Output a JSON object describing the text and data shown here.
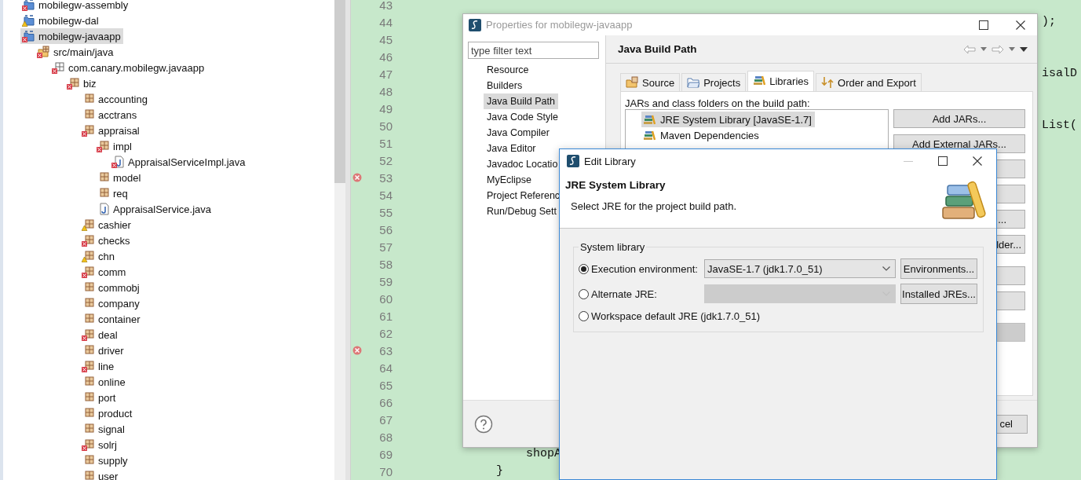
{
  "project_explorer": {
    "items": [
      {
        "label": "mobilegw-assembly",
        "kind": "project",
        "error": true,
        "warning": false,
        "selected": false
      },
      {
        "label": "mobilegw-dal",
        "kind": "project",
        "error": false,
        "warning": true,
        "selected": false
      },
      {
        "label": "mobilegw-javaapp",
        "kind": "project",
        "error": true,
        "warning": false,
        "selected": true,
        "children": [
          {
            "label": "src/main/java",
            "kind": "source-folder",
            "error": true,
            "warning": false,
            "selected": false,
            "children": [
              {
                "label": "com.canary.mobilegw.javaapp",
                "kind": "empty-package",
                "error": true,
                "warning": false,
                "selected": false,
                "children": [
                  {
                    "label": "biz",
                    "kind": "package",
                    "error": true,
                    "warning": false,
                    "selected": false,
                    "children": [
                      {
                        "label": "accounting",
                        "kind": "package",
                        "error": false,
                        "warning": false,
                        "selected": false
                      },
                      {
                        "label": "acctrans",
                        "kind": "package",
                        "error": false,
                        "warning": false,
                        "selected": false
                      },
                      {
                        "label": "appraisal",
                        "kind": "package",
                        "error": true,
                        "warning": false,
                        "selected": false,
                        "children": [
                          {
                            "label": "impl",
                            "kind": "package",
                            "error": true,
                            "warning": false,
                            "selected": false,
                            "children": [
                              {
                                "label": "AppraisalServiceImpl.java",
                                "kind": "file",
                                "error": true,
                                "warning": false,
                                "selected": false
                              }
                            ]
                          },
                          {
                            "label": "model",
                            "kind": "package",
                            "error": false,
                            "warning": false,
                            "selected": false
                          },
                          {
                            "label": "req",
                            "kind": "package",
                            "error": false,
                            "warning": false,
                            "selected": false
                          },
                          {
                            "label": "AppraisalService.java",
                            "kind": "file",
                            "error": false,
                            "warning": false,
                            "selected": false
                          }
                        ]
                      },
                      {
                        "label": "cashier",
                        "kind": "package",
                        "error": false,
                        "warning": true,
                        "selected": false
                      },
                      {
                        "label": "checks",
                        "kind": "package",
                        "error": true,
                        "warning": false,
                        "selected": false
                      },
                      {
                        "label": "chn",
                        "kind": "package",
                        "error": false,
                        "warning": true,
                        "selected": false
                      },
                      {
                        "label": "comm",
                        "kind": "package",
                        "error": true,
                        "warning": false,
                        "selected": false
                      },
                      {
                        "label": "commobj",
                        "kind": "package",
                        "error": false,
                        "warning": false,
                        "selected": false
                      },
                      {
                        "label": "company",
                        "kind": "package",
                        "error": false,
                        "warning": false,
                        "selected": false
                      },
                      {
                        "label": "container",
                        "kind": "package",
                        "error": false,
                        "warning": false,
                        "selected": false
                      },
                      {
                        "label": "deal",
                        "kind": "package",
                        "error": true,
                        "warning": false,
                        "selected": false
                      },
                      {
                        "label": "driver",
                        "kind": "package",
                        "error": false,
                        "warning": false,
                        "selected": false
                      },
                      {
                        "label": "line",
                        "kind": "package",
                        "error": true,
                        "warning": false,
                        "selected": false
                      },
                      {
                        "label": "online",
                        "kind": "package",
                        "error": false,
                        "warning": false,
                        "selected": false
                      },
                      {
                        "label": "port",
                        "kind": "package",
                        "error": false,
                        "warning": false,
                        "selected": false
                      },
                      {
                        "label": "product",
                        "kind": "package",
                        "error": false,
                        "warning": false,
                        "selected": false
                      },
                      {
                        "label": "signal",
                        "kind": "package",
                        "error": false,
                        "warning": false,
                        "selected": false
                      },
                      {
                        "label": "solrj",
                        "kind": "package",
                        "error": true,
                        "warning": false,
                        "selected": false
                      },
                      {
                        "label": "supply",
                        "kind": "package",
                        "error": false,
                        "warning": false,
                        "selected": false
                      },
                      {
                        "label": "user",
                        "kind": "package",
                        "error": false,
                        "warning": false,
                        "selected": false
                      }
                    ]
                  }
                ]
              }
            ]
          }
        ]
      }
    ]
  },
  "editor": {
    "lines": [
      {
        "number": "43",
        "error": false
      },
      {
        "number": "44",
        "error": false,
        "code": ");",
        "kind": "tail"
      },
      {
        "number": "45",
        "error": false
      },
      {
        "number": "46",
        "error": false
      },
      {
        "number": "47",
        "error": false,
        "code": "isalD",
        "kind": "tail"
      },
      {
        "number": "48",
        "error": false
      },
      {
        "number": "49",
        "error": false
      },
      {
        "number": "50",
        "error": false,
        "code": "List(",
        "kind": "tail"
      },
      {
        "number": "51",
        "error": false
      },
      {
        "number": "52",
        "error": false
      },
      {
        "number": "53",
        "error": true
      },
      {
        "number": "54",
        "error": false
      },
      {
        "number": "55",
        "error": false
      },
      {
        "number": "56",
        "error": false
      },
      {
        "number": "57",
        "error": false
      },
      {
        "number": "58",
        "error": false
      },
      {
        "number": "59",
        "error": false
      },
      {
        "number": "60",
        "error": false
      },
      {
        "number": "61",
        "error": false
      },
      {
        "number": "62",
        "error": false
      },
      {
        "number": "63",
        "error": true
      },
      {
        "number": "64",
        "error": false
      },
      {
        "number": "65",
        "error": false
      },
      {
        "number": "66",
        "error": false
      },
      {
        "number": "67",
        "error": false
      },
      {
        "number": "68",
        "error": false
      },
      {
        "number": "69",
        "error": false,
        "code": "shopA",
        "kind": "inner"
      },
      {
        "number": "70",
        "error": false,
        "code": "}",
        "kind": "outer"
      }
    ]
  },
  "properties_dialog": {
    "title": "Properties for mobilegw-javaapp",
    "filter": {
      "placeholder": "type filter text"
    },
    "pages": [
      {
        "label": "Resource",
        "selected": false
      },
      {
        "label": "Builders",
        "selected": false
      },
      {
        "label": "Java Build Path",
        "selected": true
      },
      {
        "label": "Java Code Style",
        "selected": false
      },
      {
        "label": "Java Compiler",
        "selected": false
      },
      {
        "label": "Java Editor",
        "selected": false
      },
      {
        "label": "Javadoc Locatio",
        "selected": false
      },
      {
        "label": "MyEclipse",
        "selected": false
      },
      {
        "label": "Project Referenc",
        "selected": false
      },
      {
        "label": "Run/Debug Sett",
        "selected": false
      }
    ],
    "page_title": "Java Build Path",
    "tabs": [
      {
        "label": "Source",
        "selected": false
      },
      {
        "label": "Projects",
        "selected": false
      },
      {
        "label": "Libraries",
        "selected": true
      },
      {
        "label": "Order and Export",
        "selected": false
      }
    ],
    "list_label": "JARs and class folders on the build path:",
    "libraries": [
      {
        "label": "JRE System Library [JavaSE-1.7]",
        "selected": true
      },
      {
        "label": "Maven Dependencies",
        "selected": false
      }
    ],
    "buttons": [
      {
        "label": "Add JARs...",
        "disabled": false
      },
      {
        "label": "Add External JARs...",
        "disabled": false
      },
      {
        "disabled": false
      },
      {
        "disabled": false
      },
      {
        "label": "...",
        "disabled": false
      },
      {
        "label": "lder...",
        "disabled": false
      },
      {
        "disabled": false
      },
      {
        "disabled": false
      },
      {
        "disabled": true
      }
    ],
    "footer_buttons": [
      {
        "label": "cel"
      }
    ]
  },
  "edit_library_dialog": {
    "title": "Edit Library",
    "heading": "JRE System Library",
    "description": "Select JRE for the project build path.",
    "group": "System library",
    "options": [
      {
        "label": "Execution environment:",
        "selected": true,
        "combo": {
          "value": "JavaSE-1.7 (jdk1.7.0_51)",
          "disabled": false
        },
        "button": "Environments..."
      },
      {
        "label": "Alternate JRE:",
        "selected": false,
        "combo": {
          "disabled": true
        },
        "button": "Installed JREs..."
      },
      {
        "label": "Workspace default JRE (jdk1.7.0_51)",
        "selected": false
      }
    ]
  }
}
